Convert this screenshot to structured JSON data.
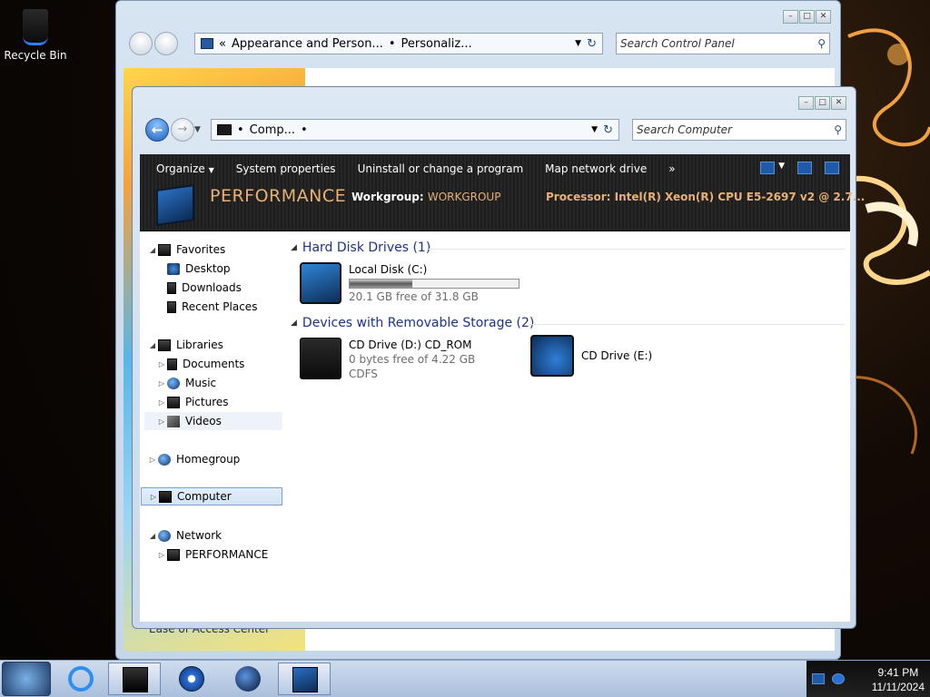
{
  "desktop": {
    "recycle_bin_label": "Recycle Bin"
  },
  "control_panel": {
    "address_chevron": "«",
    "address_parts": [
      "Appearance and Person...",
      "Personaliz..."
    ],
    "search_placeholder": "Search Control Panel",
    "ease_link": "Ease of Access Center"
  },
  "explorer": {
    "address_parts": [
      "Comp..."
    ],
    "search_placeholder": "Search Computer",
    "toolbar": {
      "organize": "Organize",
      "system_properties": "System properties",
      "uninstall": "Uninstall or change a program",
      "map_drive": "Map network drive",
      "more": "»"
    },
    "details": {
      "computer_name": "PERFORMANCE",
      "workgroup_label": "Workgroup:",
      "workgroup_value": "WORKGROUP",
      "processor_label": "Processor:",
      "processor_value": "Intel(R) Xeon(R) CPU E5-2697 v2 @ 2.7..."
    },
    "nav": {
      "favorites": "Favorites",
      "desktop": "Desktop",
      "downloads": "Downloads",
      "recent_places": "Recent Places",
      "libraries": "Libraries",
      "documents": "Documents",
      "music": "Music",
      "pictures": "Pictures",
      "videos": "Videos",
      "homegroup": "Homegroup",
      "computer": "Computer",
      "network": "Network",
      "network_pc": "PERFORMANCE"
    },
    "groups": {
      "hard_disks": "Hard Disk Drives (1)",
      "removable": "Devices with Removable Storage (2)"
    },
    "drives": {
      "c": {
        "name": "Local Disk (C:)",
        "free": "20.1 GB free of 31.8 GB",
        "used_fraction": 0.37
      },
      "d": {
        "name": "CD Drive (D:) CD_ROM",
        "free": "0 bytes free of 4.22 GB",
        "fs": "CDFS"
      },
      "e": {
        "name": "CD Drive (E:)"
      }
    }
  },
  "taskbar": {
    "time": "9:41 PM",
    "date": "11/11/2024"
  }
}
